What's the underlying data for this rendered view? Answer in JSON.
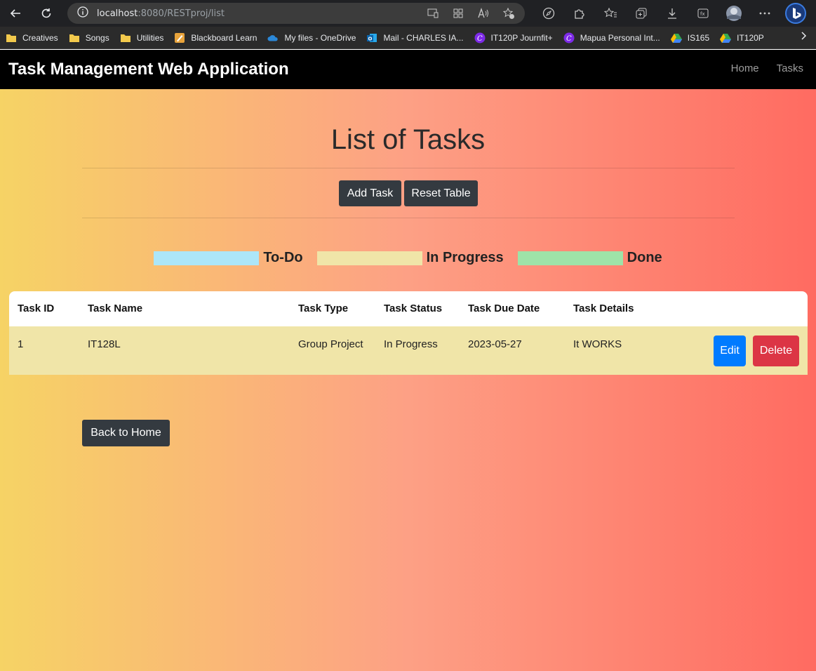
{
  "browser": {
    "url_host": "localhost",
    "url_rest": ":8080/RESTproj/list",
    "bookmarks": [
      {
        "label": "Creatives",
        "icon": "folder-icon"
      },
      {
        "label": "Songs",
        "icon": "folder-icon"
      },
      {
        "label": "Utilities",
        "icon": "folder-icon"
      },
      {
        "label": "Blackboard Learn",
        "icon": "blackboard-icon"
      },
      {
        "label": "My files - OneDrive",
        "icon": "onedrive-icon"
      },
      {
        "label": "Mail - CHARLES IA...",
        "icon": "outlook-icon"
      },
      {
        "label": "IT120P Journfit+",
        "icon": "canva-icon"
      },
      {
        "label": "Mapua Personal Int...",
        "icon": "canva-icon"
      },
      {
        "label": "IS165",
        "icon": "drive-icon"
      },
      {
        "label": "IT120P",
        "icon": "drive-icon"
      }
    ]
  },
  "navbar": {
    "brand": "Task Management Web Application",
    "links": [
      "Home",
      "Tasks"
    ]
  },
  "page": {
    "title": "List of Tasks",
    "add_task": "Add Task",
    "reset_table": "Reset Table",
    "back_home": "Back to Home"
  },
  "legend": [
    {
      "label": "To-Do",
      "color": "#ace6f8"
    },
    {
      "label": "In Progress",
      "color": "#f0e5a8"
    },
    {
      "label": "Done",
      "color": "#9ee3a8"
    }
  ],
  "table": {
    "headers": [
      "Task ID",
      "Task Name",
      "Task Type",
      "Task Status",
      "Task Due Date",
      "Task Details"
    ],
    "rows": [
      {
        "id": "1",
        "name": "IT128L",
        "type": "Group Project",
        "status": "In Progress",
        "due": "2023-05-27",
        "details": "It WORKS",
        "edit": "Edit",
        "delete": "Delete"
      }
    ]
  }
}
